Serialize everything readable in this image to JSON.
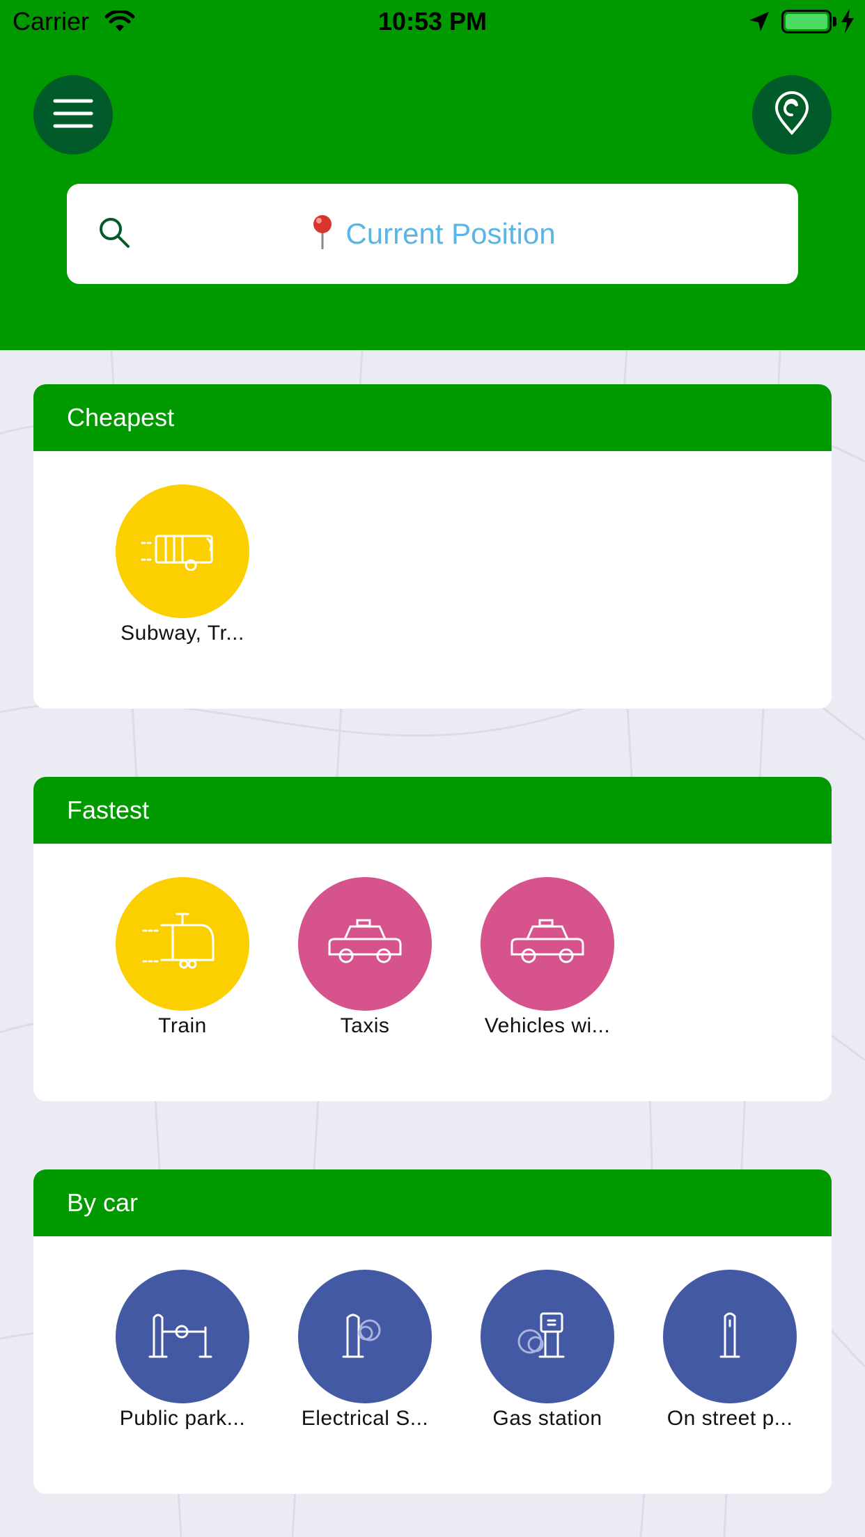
{
  "status_bar": {
    "carrier": "Carrier",
    "time": "10:53 PM"
  },
  "header": {
    "menu_icon": "hamburger-menu-icon",
    "location_icon": "map-pin-icon",
    "search": {
      "icon": "search-icon",
      "location_emoji": "📍",
      "text": "Current Position"
    },
    "background_color": "#009a00"
  },
  "sections": [
    {
      "title": "Cheapest",
      "items": [
        {
          "label": "Subway, Tr...",
          "icon": "subway-icon",
          "color": "#fccf00"
        }
      ]
    },
    {
      "title": "Fastest",
      "items": [
        {
          "label": "Train",
          "icon": "train-icon",
          "color": "#fccf00"
        },
        {
          "label": "Taxis",
          "icon": "taxi-icon",
          "color": "#d6538d"
        },
        {
          "label": "Vehicles wi...",
          "icon": "taxi-icon",
          "color": "#d6538d"
        }
      ]
    },
    {
      "title": "By car",
      "items": [
        {
          "label": "Public park...",
          "icon": "parking-barrier-icon",
          "color": "#4459a3"
        },
        {
          "label": "Electrical S...",
          "icon": "electric-station-icon",
          "color": "#4459a3"
        },
        {
          "label": "Gas station",
          "icon": "gas-pump-icon",
          "color": "#4459a3"
        },
        {
          "label": "On street p...",
          "icon": "street-parking-icon",
          "color": "#4459a3"
        }
      ]
    }
  ]
}
